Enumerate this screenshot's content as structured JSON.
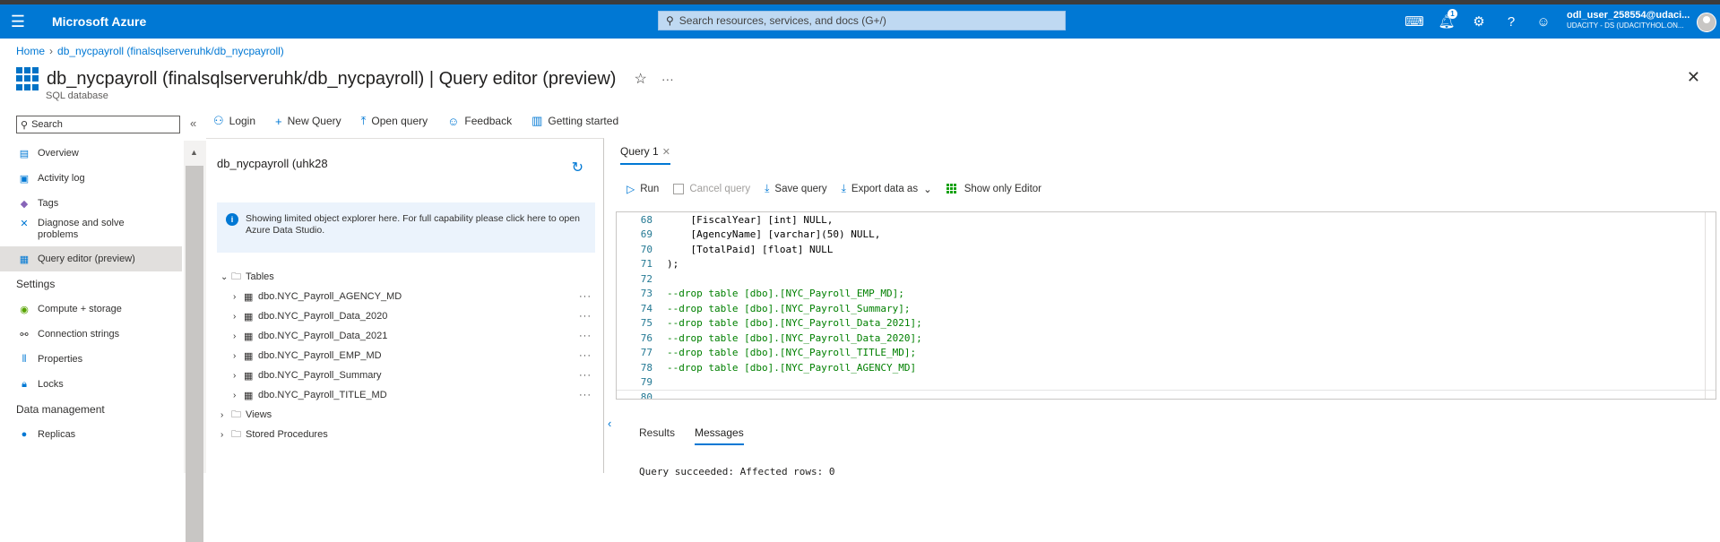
{
  "topbar": {
    "brand": "Microsoft Azure",
    "search_placeholder": "Search resources, services, and docs (G+/)",
    "notification_count": "1",
    "account_name": "odl_user_258554@udaci...",
    "account_tenant": "UDACITY - DS (UDACITYHOL.ON..."
  },
  "breadcrumb": {
    "home": "Home",
    "current": "db_nycpayroll (finalsqlserveruhk/db_nycpayroll)"
  },
  "page": {
    "title": "db_nycpayroll (finalsqlserveruhk/db_nycpayroll) | Query editor (preview)",
    "subtitle": "SQL database"
  },
  "nav": {
    "search_placeholder": "Search",
    "items": [
      {
        "label": "Overview",
        "icon": "database-icon"
      },
      {
        "label": "Activity log",
        "icon": "activity-log-icon"
      },
      {
        "label": "Tags",
        "icon": "tag-icon"
      },
      {
        "label": "Diagnose and solve problems",
        "icon": "diagnose-icon"
      },
      {
        "label": "Query editor (preview)",
        "icon": "query-editor-icon"
      }
    ],
    "settings_header": "Settings",
    "settings_items": [
      {
        "label": "Compute + storage",
        "icon": "compute-icon"
      },
      {
        "label": "Connection strings",
        "icon": "connection-icon"
      },
      {
        "label": "Properties",
        "icon": "properties-icon"
      },
      {
        "label": "Locks",
        "icon": "lock-icon"
      }
    ],
    "data_header": "Data management",
    "data_items": [
      {
        "label": "Replicas",
        "icon": "replicas-icon"
      }
    ]
  },
  "toolbar": {
    "login": "Login",
    "new_query": "New Query",
    "open_query": "Open query",
    "feedback": "Feedback",
    "getting_started": "Getting started"
  },
  "explorer": {
    "title": "db_nycpayroll (uhk28",
    "info": "Showing limited object explorer here. For full capability please click here to open Azure Data Studio.",
    "tables_label": "Tables",
    "tables": [
      "dbo.NYC_Payroll_AGENCY_MD",
      "dbo.NYC_Payroll_Data_2020",
      "dbo.NYC_Payroll_Data_2021",
      "dbo.NYC_Payroll_EMP_MD",
      "dbo.NYC_Payroll_Summary",
      "dbo.NYC_Payroll_TITLE_MD"
    ],
    "views_label": "Views",
    "procs_label": "Stored Procedures"
  },
  "editor": {
    "tab_label": "Query 1",
    "run": "Run",
    "cancel": "Cancel query",
    "save": "Save query",
    "export": "Export data as",
    "show_editor": "Show only Editor",
    "lines": [
      {
        "n": "68",
        "text": "    [FiscalYear] [int] NULL,"
      },
      {
        "n": "69",
        "text": "    [AgencyName] [varchar](50) NULL,"
      },
      {
        "n": "70",
        "text": "    [TotalPaid] [float] NULL"
      },
      {
        "n": "71",
        "text": ");"
      },
      {
        "n": "72",
        "text": ""
      },
      {
        "n": "73",
        "text": "--drop table [dbo].[NYC_Payroll_EMP_MD];"
      },
      {
        "n": "74",
        "text": "--drop table [dbo].[NYC_Payroll_Summary];"
      },
      {
        "n": "75",
        "text": "--drop table [dbo].[NYC_Payroll_Data_2021];"
      },
      {
        "n": "76",
        "text": "--drop table [dbo].[NYC_Payroll_Data_2020];"
      },
      {
        "n": "77",
        "text": "--drop table [dbo].[NYC_Payroll_TITLE_MD];"
      },
      {
        "n": "78",
        "text": "--drop table [dbo].[NYC_Payroll_AGENCY_MD]"
      },
      {
        "n": "79",
        "text": ""
      },
      {
        "n": "80",
        "text": ""
      }
    ],
    "results_tab": "Results",
    "messages_tab": "Messages",
    "message_text": "Query succeeded: Affected rows: 0"
  }
}
